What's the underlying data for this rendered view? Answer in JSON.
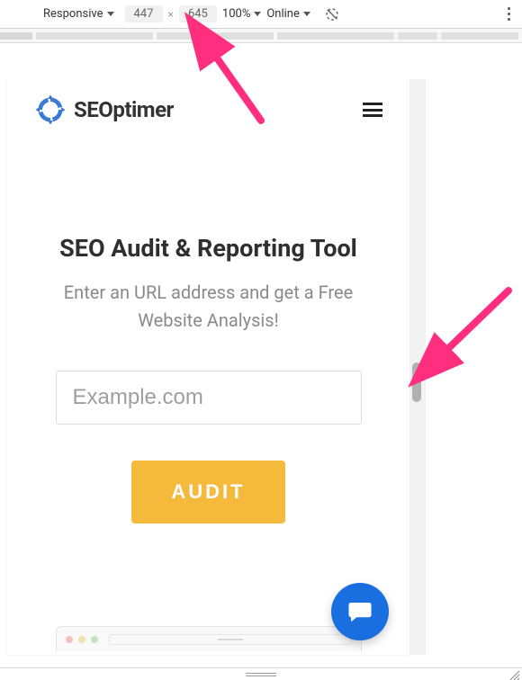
{
  "devtools": {
    "device_label": "Responsive",
    "width": "447",
    "height": "645",
    "zoom": "100%",
    "throttle": "Online"
  },
  "site": {
    "brand": "SEOptimer",
    "hero_title": "SEO Audit & Reporting Tool",
    "hero_sub": "Enter an URL address and get a Free Website Analysis!",
    "url_placeholder": "Example.com",
    "audit_label": "AUDIT"
  },
  "colors": {
    "accent_blue": "#3a7bd5",
    "audit_yellow": "#f5b93b",
    "chat_blue": "#1a6fe0",
    "annotation_pink": "#ff2e7e"
  }
}
